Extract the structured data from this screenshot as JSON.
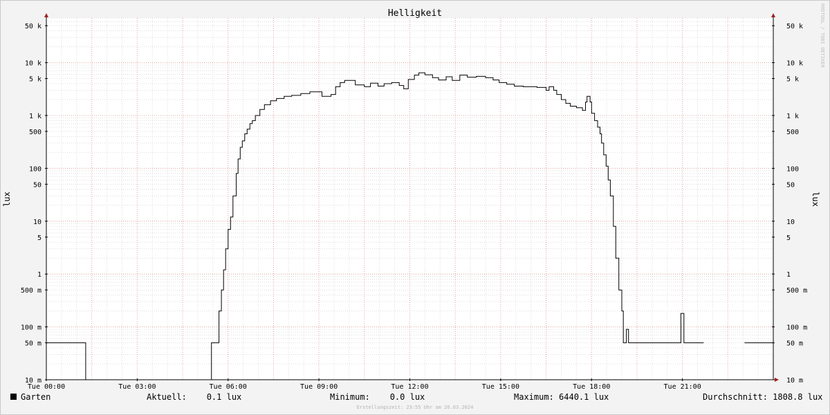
{
  "chart_data": {
    "type": "line",
    "title": "Helligkeit",
    "ylabel": "lux",
    "y_scale": "log",
    "ylim": [
      0.01,
      70000
    ],
    "xlim_hours": [
      0,
      24
    ],
    "x_ticks": [
      {
        "h": 0,
        "label": "Tue 00:00"
      },
      {
        "h": 3,
        "label": "Tue 03:00"
      },
      {
        "h": 6,
        "label": "Tue 06:00"
      },
      {
        "h": 9,
        "label": "Tue 09:00"
      },
      {
        "h": 12,
        "label": "Tue 12:00"
      },
      {
        "h": 15,
        "label": "Tue 15:00"
      },
      {
        "h": 18,
        "label": "Tue 18:00"
      },
      {
        "h": 21,
        "label": "Tue 21:00"
      }
    ],
    "y_ticks": [
      {
        "v": 0.01,
        "label": "10 m"
      },
      {
        "v": 0.05,
        "label": "50 m"
      },
      {
        "v": 0.1,
        "label": "100 m"
      },
      {
        "v": 0.5,
        "label": "500 m"
      },
      {
        "v": 1,
        "label": "1"
      },
      {
        "v": 5,
        "label": "5"
      },
      {
        "v": 10,
        "label": "10"
      },
      {
        "v": 50,
        "label": "50"
      },
      {
        "v": 100,
        "label": "100"
      },
      {
        "v": 500,
        "label": "500"
      },
      {
        "v": 1000,
        "label": "1 k"
      },
      {
        "v": 5000,
        "label": "5 k"
      },
      {
        "v": 10000,
        "label": "10 k"
      },
      {
        "v": 50000,
        "label": "50 k"
      }
    ],
    "grid": true,
    "legend_position": "bottom-left",
    "series": [
      {
        "name": "Garten",
        "color": "#000000",
        "segments": [
          [
            [
              0,
              0.05
            ],
            [
              1.3,
              0.05
            ],
            [
              1.3,
              0.01
            ],
            [
              5.45,
              0.01
            ],
            [
              5.45,
              0.05
            ],
            [
              5.7,
              0.05
            ],
            [
              5.7,
              0.2
            ],
            [
              5.78,
              0.2
            ],
            [
              5.78,
              0.5
            ],
            [
              5.85,
              0.5
            ],
            [
              5.85,
              1.2
            ],
            [
              5.92,
              1.2
            ],
            [
              5.92,
              3
            ],
            [
              6.0,
              3
            ],
            [
              6.0,
              7
            ],
            [
              6.08,
              7
            ],
            [
              6.08,
              12
            ],
            [
              6.16,
              12
            ],
            [
              6.16,
              30
            ],
            [
              6.27,
              30
            ],
            [
              6.27,
              80
            ],
            [
              6.33,
              80
            ],
            [
              6.33,
              150
            ],
            [
              6.4,
              150
            ],
            [
              6.4,
              250
            ],
            [
              6.47,
              250
            ],
            [
              6.47,
              330
            ],
            [
              6.55,
              330
            ],
            [
              6.55,
              450
            ],
            [
              6.63,
              450
            ],
            [
              6.63,
              550
            ],
            [
              6.72,
              550
            ],
            [
              6.72,
              700
            ],
            [
              6.8,
              700
            ],
            [
              6.8,
              800
            ],
            [
              6.9,
              800
            ],
            [
              6.9,
              1000
            ],
            [
              7.05,
              1000
            ],
            [
              7.05,
              1300
            ],
            [
              7.2,
              1300
            ],
            [
              7.2,
              1600
            ],
            [
              7.4,
              1600
            ],
            [
              7.4,
              1900
            ],
            [
              7.6,
              1900
            ],
            [
              7.6,
              2100
            ],
            [
              7.85,
              2100
            ],
            [
              7.85,
              2300
            ],
            [
              8.1,
              2300
            ],
            [
              8.1,
              2400
            ],
            [
              8.4,
              2400
            ],
            [
              8.4,
              2600
            ],
            [
              8.7,
              2600
            ],
            [
              8.7,
              2800
            ],
            [
              9.1,
              2800
            ],
            [
              9.1,
              2300
            ],
            [
              9.4,
              2300
            ],
            [
              9.4,
              2500
            ],
            [
              9.55,
              2500
            ],
            [
              9.55,
              3500
            ],
            [
              9.7,
              3500
            ],
            [
              9.7,
              4200
            ],
            [
              9.85,
              4200
            ],
            [
              9.85,
              4600
            ],
            [
              10.2,
              4600
            ],
            [
              10.2,
              3800
            ],
            [
              10.5,
              3800
            ],
            [
              10.5,
              3500
            ],
            [
              10.7,
              3500
            ],
            [
              10.7,
              4100
            ],
            [
              10.95,
              4100
            ],
            [
              10.95,
              3600
            ],
            [
              11.15,
              3600
            ],
            [
              11.15,
              4000
            ],
            [
              11.4,
              4000
            ],
            [
              11.4,
              4200
            ],
            [
              11.65,
              4200
            ],
            [
              11.65,
              3700
            ],
            [
              11.8,
              3700
            ],
            [
              11.8,
              3200
            ],
            [
              11.95,
              3200
            ],
            [
              11.95,
              4800
            ],
            [
              12.15,
              4800
            ],
            [
              12.15,
              5800
            ],
            [
              12.3,
              5800
            ],
            [
              12.3,
              6440
            ],
            [
              12.5,
              6440
            ],
            [
              12.5,
              5900
            ],
            [
              12.75,
              5900
            ],
            [
              12.75,
              5200
            ],
            [
              12.95,
              5200
            ],
            [
              12.95,
              4700
            ],
            [
              13.2,
              4700
            ],
            [
              13.2,
              5400
            ],
            [
              13.4,
              5400
            ],
            [
              13.4,
              4600
            ],
            [
              13.65,
              4600
            ],
            [
              13.65,
              5800
            ],
            [
              13.9,
              5800
            ],
            [
              13.9,
              5300
            ],
            [
              14.2,
              5300
            ],
            [
              14.2,
              5500
            ],
            [
              14.5,
              5500
            ],
            [
              14.5,
              5200
            ],
            [
              14.75,
              5200
            ],
            [
              14.75,
              4700
            ],
            [
              14.95,
              4700
            ],
            [
              14.95,
              4200
            ],
            [
              15.2,
              4200
            ],
            [
              15.2,
              3900
            ],
            [
              15.45,
              3900
            ],
            [
              15.45,
              3600
            ],
            [
              15.75,
              3600
            ],
            [
              15.75,
              3500
            ],
            [
              16.2,
              3500
            ],
            [
              16.2,
              3400
            ],
            [
              16.5,
              3400
            ],
            [
              16.5,
              3000
            ],
            [
              16.6,
              3000
            ],
            [
              16.6,
              3500
            ],
            [
              16.75,
              3500
            ],
            [
              16.75,
              3000
            ],
            [
              16.85,
              3000
            ],
            [
              16.85,
              2500
            ],
            [
              17.0,
              2500
            ],
            [
              17.0,
              2000
            ],
            [
              17.15,
              2000
            ],
            [
              17.15,
              1700
            ],
            [
              17.3,
              1700
            ],
            [
              17.3,
              1500
            ],
            [
              17.5,
              1500
            ],
            [
              17.5,
              1400
            ],
            [
              17.7,
              1400
            ],
            [
              17.7,
              1250
            ],
            [
              17.8,
              1250
            ],
            [
              17.8,
              1800
            ],
            [
              17.85,
              1800
            ],
            [
              17.85,
              2300
            ],
            [
              17.95,
              2300
            ],
            [
              17.95,
              1800
            ],
            [
              18.0,
              1800
            ],
            [
              18.0,
              1100
            ],
            [
              18.1,
              1100
            ],
            [
              18.1,
              800
            ],
            [
              18.2,
              800
            ],
            [
              18.2,
              600
            ],
            [
              18.28,
              600
            ],
            [
              18.28,
              450
            ],
            [
              18.33,
              450
            ],
            [
              18.33,
              300
            ],
            [
              18.4,
              300
            ],
            [
              18.4,
              180
            ],
            [
              18.48,
              180
            ],
            [
              18.48,
              110
            ],
            [
              18.55,
              110
            ],
            [
              18.55,
              60
            ],
            [
              18.62,
              60
            ],
            [
              18.62,
              30
            ],
            [
              18.72,
              30
            ],
            [
              18.72,
              8
            ],
            [
              18.8,
              8
            ],
            [
              18.8,
              2
            ],
            [
              18.9,
              2
            ],
            [
              18.9,
              0.5
            ],
            [
              19.0,
              0.5
            ],
            [
              19.0,
              0.2
            ],
            [
              19.05,
              0.2
            ],
            [
              19.05,
              0.05
            ],
            [
              19.15,
              0.05
            ],
            [
              19.15,
              0.09
            ],
            [
              19.22,
              0.09
            ],
            [
              19.22,
              0.05
            ],
            [
              20.95,
              0.05
            ],
            [
              20.95,
              0.18
            ],
            [
              21.05,
              0.18
            ],
            [
              21.05,
              0.05
            ],
            [
              21.7,
              0.05
            ]
          ],
          [
            [
              23.05,
              0.05
            ],
            [
              24,
              0.05
            ]
          ]
        ]
      }
    ]
  },
  "legend": {
    "series_name": "Garten",
    "current": "Aktuell:    0.1 lux",
    "minimum": "Minimum:    0.0 lux",
    "maximum": "Maximum: 6440.1 lux",
    "average": "Durchschnitt: 1808.8 lux"
  },
  "footer": "Erstellungszeit: 23:55 Uhr am 26.03.2024",
  "watermark": "RRDTOOL / TOBI OETIKER",
  "colors": {
    "background": "#f3f3f3",
    "canvas": "#ffffff",
    "grid_minor": "#dcdcdc",
    "grid_major": "#e3a0a0",
    "axis": "#000000",
    "arrow": "#a02020"
  }
}
